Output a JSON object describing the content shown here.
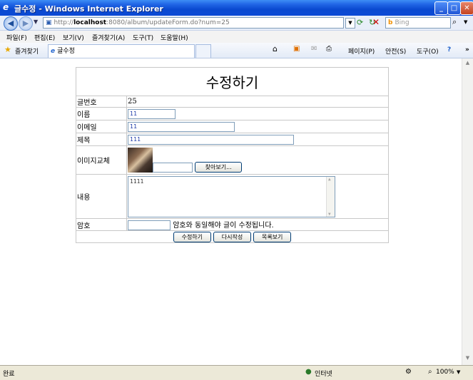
{
  "window": {
    "title": "글수정 - Windows Internet Explorer",
    "min": "_",
    "max": "□",
    "close": "✕"
  },
  "nav": {
    "url_prefix": "http://",
    "url_host": "localhost",
    "url_rest": ":8080/album/updateForm.do?num=25",
    "search_placeholder": "Bing"
  },
  "menu": [
    "파일(F)",
    "편집(E)",
    "보기(V)",
    "즐겨찾기(A)",
    "도구(T)",
    "도움말(H)"
  ],
  "favbar": {
    "favorites": "즐겨찾기",
    "tab_title": "글수정",
    "page_menu": "페이지(P)",
    "safety_menu": "안전(S)",
    "tools_menu": "도구(O)"
  },
  "form": {
    "heading": "수정하기",
    "num_label": "글번호",
    "num_value": "25",
    "name_label": "이름",
    "name_value": "11",
    "email_label": "이메일",
    "email_value": "11",
    "subject_label": "제목",
    "subject_value": "111",
    "image_label": "이미지교체",
    "browse_button": "찾아보기...",
    "content_label": "내용",
    "content_value": "1111",
    "password_label": "암호",
    "password_hint": "암호와 동일해야 글이 수정됩니다.",
    "submit_button": "수정하기",
    "reset_button": "다시작성",
    "list_button": "목록보기"
  },
  "status": {
    "text": "완료",
    "zone": "인터넷",
    "zoom": "100%"
  }
}
